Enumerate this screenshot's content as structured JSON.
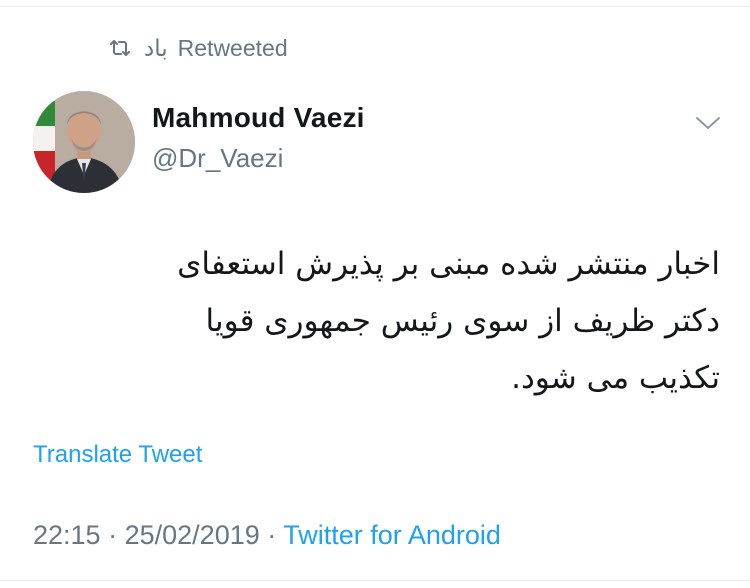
{
  "retweet": {
    "user": "باد",
    "label": "Retweeted",
    "icon": "retweet-icon"
  },
  "author": {
    "name": "Mahmoud Vaezi",
    "handle": "@Dr_Vaezi",
    "avatar": "avatar-photo"
  },
  "tweet": {
    "text": "اخبار منتشر شده مبنی بر پذیرش استعفای\nدکتر ظریف از سوی رئیس جمهوری قویا\nتکذیب می شود."
  },
  "translate_label": "Translate Tweet",
  "meta": {
    "time": "22:15",
    "separator": "·",
    "date": "25/02/2019",
    "client": "Twitter for Android"
  },
  "colors": {
    "accent": "#1da1f2",
    "secondary": "#657786",
    "text": "#14171a"
  }
}
